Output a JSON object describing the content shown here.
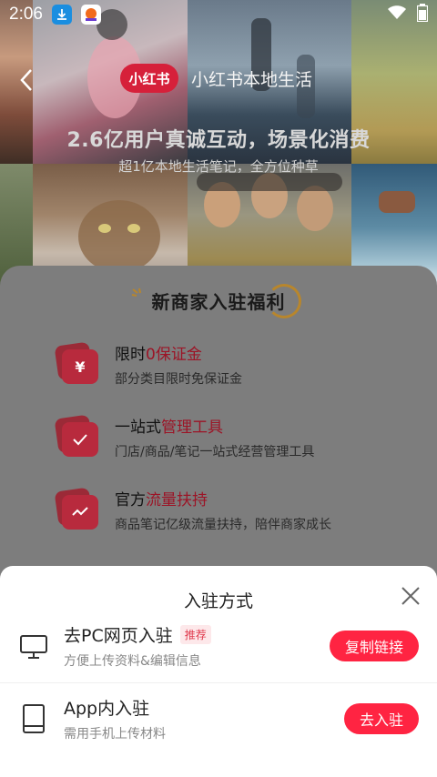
{
  "status_bar": {
    "time": "2:06",
    "icons": [
      "download-icon",
      "app-notification-icon",
      "wifi-icon",
      "battery-icon"
    ]
  },
  "hero": {
    "brand_logo": "小红书",
    "brand_text": "小红书本地生活",
    "headline": "2.6亿用户真诚互动，场景化消费",
    "subline": "超1亿本地生活笔记，全方位种草"
  },
  "benefits": {
    "title": "新商家入驻福利",
    "items": [
      {
        "title_prefix": "限时",
        "title_highlight": "0保证金",
        "desc": "部分类目限时免保证金",
        "icon": "yen-icon"
      },
      {
        "title_prefix": "一站式",
        "title_highlight": "管理工具",
        "desc": "门店/商品/笔记一站式经营管理工具",
        "icon": "check-icon"
      },
      {
        "title_prefix": "官方",
        "title_highlight": "流量扶持",
        "desc": "商品笔记亿级流量扶持，陪伴商家成长",
        "icon": "trend-icon"
      }
    ]
  },
  "sheet": {
    "title": "入驻方式",
    "options": [
      {
        "title": "去PC网页入驻",
        "badge": "推荐",
        "desc": "方便上传资料&编辑信息",
        "button": "复制链接",
        "icon": "monitor-icon"
      },
      {
        "title": "App内入驻",
        "desc": "需用手机上传材料",
        "button": "去入驻",
        "icon": "phone-icon"
      }
    ]
  },
  "colors": {
    "accent": "#ff2442",
    "brand": "#d6203a",
    "highlight": "#9c1426"
  }
}
